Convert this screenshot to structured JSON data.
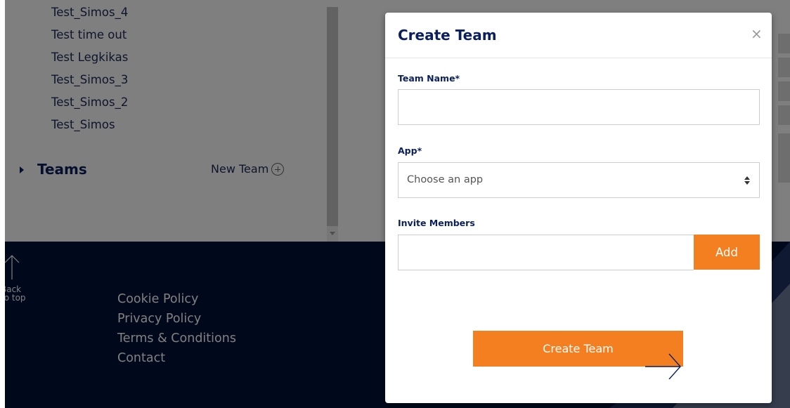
{
  "background": {
    "projects": [
      "Test_Simos_4",
      "Test time out",
      "Test Legkikas",
      "Test_Simos_3",
      "Test_Simos_2",
      "Test_Simos"
    ],
    "teams_heading": "Teams",
    "new_team_label": "New Team"
  },
  "footer": {
    "back_to_top": [
      "Back",
      "to top"
    ],
    "links": [
      "Cookie Policy",
      "Privacy Policy",
      "Terms & Conditions",
      "Contact"
    ]
  },
  "modal": {
    "title": "Create Team",
    "close_symbol": "×",
    "team_name_label": "Team Name*",
    "team_name_value": "",
    "app_label": "App*",
    "app_select_value": "Choose an app",
    "invite_label": "Invite Members",
    "invite_value": "",
    "add_label": "Add",
    "submit_label": "Create Team"
  },
  "colors": {
    "accent_orange": "#f47f20",
    "navy": "#0b1f5c",
    "footer_bg": "#001237"
  }
}
